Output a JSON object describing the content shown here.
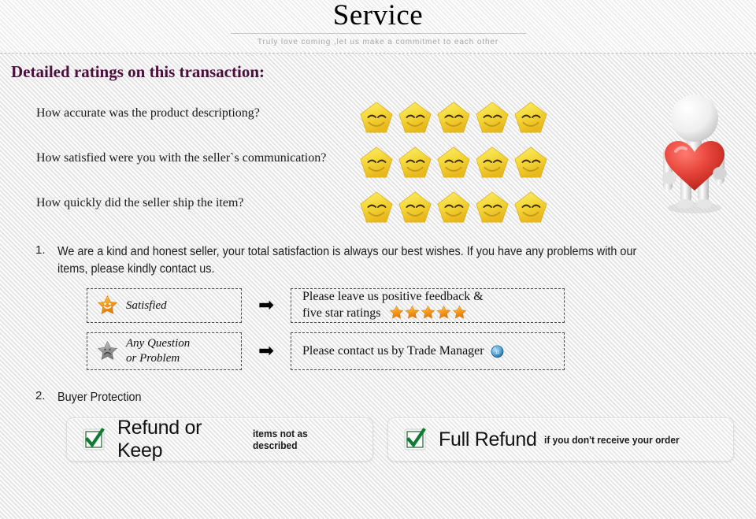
{
  "header": {
    "title": "Service",
    "tagline": "Truly love coming ,let us make a commitmet to each other"
  },
  "section": {
    "title": "Detailed ratings on this transaction:"
  },
  "ratings": {
    "star_count": 5,
    "star_icon": "smiley-star-icon",
    "rows": [
      {
        "question": "How accurate was the product descriptiong?",
        "stars": 5
      },
      {
        "question": "How satisfied were you with the seller`s communication?",
        "stars": 5
      },
      {
        "question": "How quickly did the seller ship the item?",
        "stars": 5
      }
    ],
    "mascot_icon": "person-holding-heart-icon"
  },
  "clauses": [
    {
      "number": "1.",
      "text": "We are a kind and honest seller, your total satisfaction is always our best wishes. If you have any problems with our items, please kindly contact us."
    },
    {
      "number": "2.",
      "text": "Buyer Protection"
    }
  ],
  "flows": [
    {
      "icon": "happy-star-icon",
      "label_line1": "Satisfied",
      "label_line2": "",
      "arrow": "➡",
      "result_line1": "Please leave us positive feedback &",
      "result_line2": "five star ratings",
      "result_stars": 5,
      "result_icon": ""
    },
    {
      "icon": "sad-star-icon",
      "label_line1": "Any Question",
      "label_line2": "or Problem",
      "arrow": "➡",
      "result_line1": "Please contact us by Trade Manager",
      "result_line2": "",
      "result_stars": 0,
      "result_icon": "trade-manager-icon"
    }
  ],
  "protection": [
    {
      "icon": "green-check-icon",
      "title": "Refund or Keep",
      "subtitle": "items not as described"
    },
    {
      "icon": "green-check-icon",
      "title": "Full Refund",
      "subtitle": "if you don't receive your order"
    }
  ],
  "colors": {
    "heading": "#4b0f3c",
    "star_gold": "#f2d13c",
    "star_orange": "#f5a623",
    "check_green": "#0f7a32",
    "heart_red": "#e03a33",
    "background": "#f2f2f2"
  }
}
